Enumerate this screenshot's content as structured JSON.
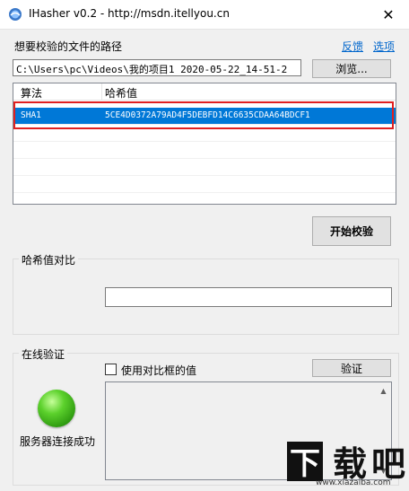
{
  "window": {
    "title": "IHasher v0.2 - http://msdn.itellyou.cn",
    "close_glyph": "✕"
  },
  "file_section": {
    "label": "想要校验的文件的路径",
    "feedback_link": "反馈",
    "options_link": "选项",
    "path_value": "C:\\Users\\pc\\Videos\\我的项目1 2020-05-22_14-51-2",
    "browse_button": "浏览..."
  },
  "hash_list": {
    "columns": [
      "算法",
      "哈希值"
    ],
    "rows": [
      {
        "algorithm": "SHA1",
        "hash": "5CE4D0372A79AD4F5DEBFD14C6635CDAA64BDCF1",
        "selected": true
      }
    ]
  },
  "start_button": "开始校验",
  "compare_section": {
    "title": "哈希值对比",
    "input_value": ""
  },
  "online_section": {
    "title": "在线验证",
    "checkbox_label": "使用对比框的值",
    "checkbox_checked": false,
    "verify_button": "验证",
    "status_text": "服务器连接成功",
    "status_color": "#3cb41c",
    "scroll_up_glyph": "▲",
    "scroll_down_glyph": "▼"
  },
  "watermark": {
    "logo_text": "下载吧",
    "url": "www.xiazaiba.com"
  },
  "colors": {
    "selection": "#0078d7",
    "highlight_border": "#e02020",
    "link": "#0066cc"
  }
}
